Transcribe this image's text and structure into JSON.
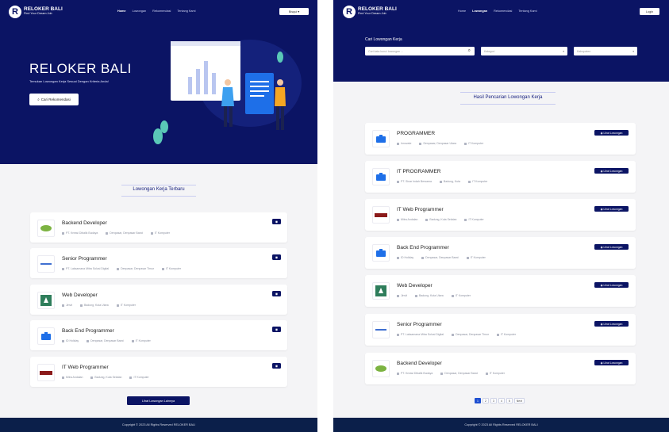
{
  "brand": {
    "name": "RELOKER BALI",
    "tagline": "Find Your Dream Job",
    "logo_letter": "R"
  },
  "left": {
    "nav": {
      "items": [
        "Home",
        "Lowongan",
        "Rekomendasi",
        "Tentang Kami"
      ],
      "active": "Home",
      "user_button": "Bisqui ▾"
    },
    "hero": {
      "title": "RELOKER BALI",
      "subtitle": "Temukan Lowongan Kerja Sesuai Dengan Kriteria Anda!",
      "button": "Cari Rekomendasi"
    },
    "section_title": "Lowongan Kerja Terbaru",
    "jobs": [
      {
        "title": "Backend Developer",
        "company": "PT. Kreasi Dibalik Budaya",
        "location": "Denpasar, Denpasar Barat",
        "category": "IT Komputer"
      },
      {
        "title": "Senior Programmer",
        "company": "PT. Laksamana Mitra Solusi Digital",
        "location": "Denpasar, Denpasar Timur",
        "category": "IT Komputer"
      },
      {
        "title": "Web Developer",
        "company": "Jinvit",
        "location": "Badung, Kuta Utara",
        "category": "IT Komputer"
      },
      {
        "title": "Back End Programmer",
        "company": "ID Holiday",
        "location": "Denpasar, Denpasar Barat",
        "category": "IT Komputer"
      },
      {
        "title": "IT Web Programmer",
        "company": "Mitra Andalan",
        "location": "Badung, Kuta Selatan",
        "category": "IT Komputer"
      }
    ],
    "more_button": "Lihat Lowongan Lainnya",
    "footer": "Copyright © 2023 All Rights Reserved RELOKER BALI"
  },
  "right": {
    "nav": {
      "items": [
        "Home",
        "Lowongan",
        "Rekomendasi",
        "Tentang Kami"
      ],
      "active": "Lowongan",
      "login_button": "Login"
    },
    "search": {
      "title": "Cari Lowongan Kerja",
      "placeholder": "Cari kata kunci lowongan ...",
      "category_select": "Kategori",
      "regency_select": "Kabupaten"
    },
    "section_title": "Hasil Pencarian Lowongan Kerja",
    "view_label": "Lihat Lowongan",
    "jobs": [
      {
        "title": "PROGRAMMER",
        "company": "Innovate",
        "location": "Denpasar, Denpasar Utara",
        "category": "IT Komputer"
      },
      {
        "title": "IT PROGRAMMER",
        "company": "PT. Sinar Indah Bersama",
        "location": "Badung, Kuta",
        "category": "IT Komputer"
      },
      {
        "title": "IT Web Programmer",
        "company": "Mitra Andalan",
        "location": "Badung, Kuta Selatan",
        "category": "IT Komputer"
      },
      {
        "title": "Back End Programmer",
        "company": "ID Holiday",
        "location": "Denpasar, Denpasar Barat",
        "category": "IT Komputer"
      },
      {
        "title": "Web Developer",
        "company": "Jinvit",
        "location": "Badung, Kuta Utara",
        "category": "IT Komputer"
      },
      {
        "title": "Senior Programmer",
        "company": "PT. Laksamana Mitra Solusi Digital",
        "location": "Denpasar, Denpasar Timur",
        "category": "IT Komputer"
      },
      {
        "title": "Backend Developer",
        "company": "PT. Kreasi Dibalik Budaya",
        "location": "Denpasar, Denpasar Barat",
        "category": "IT Komputer"
      }
    ],
    "pagination": [
      "1",
      "2",
      "3",
      "4",
      "5",
      "Next"
    ],
    "pagination_active": "1",
    "footer": "Copyright © 2023 All Rights Reserved RELOKER BALI"
  },
  "colors": {
    "navy": "#0b1464",
    "footer": "#0b1f4a",
    "page_bg": "#f4f4f6",
    "accent_blue": "#1e4fd1",
    "logo_green": "#7cb342",
    "logo_red": "#8b1a1a"
  }
}
